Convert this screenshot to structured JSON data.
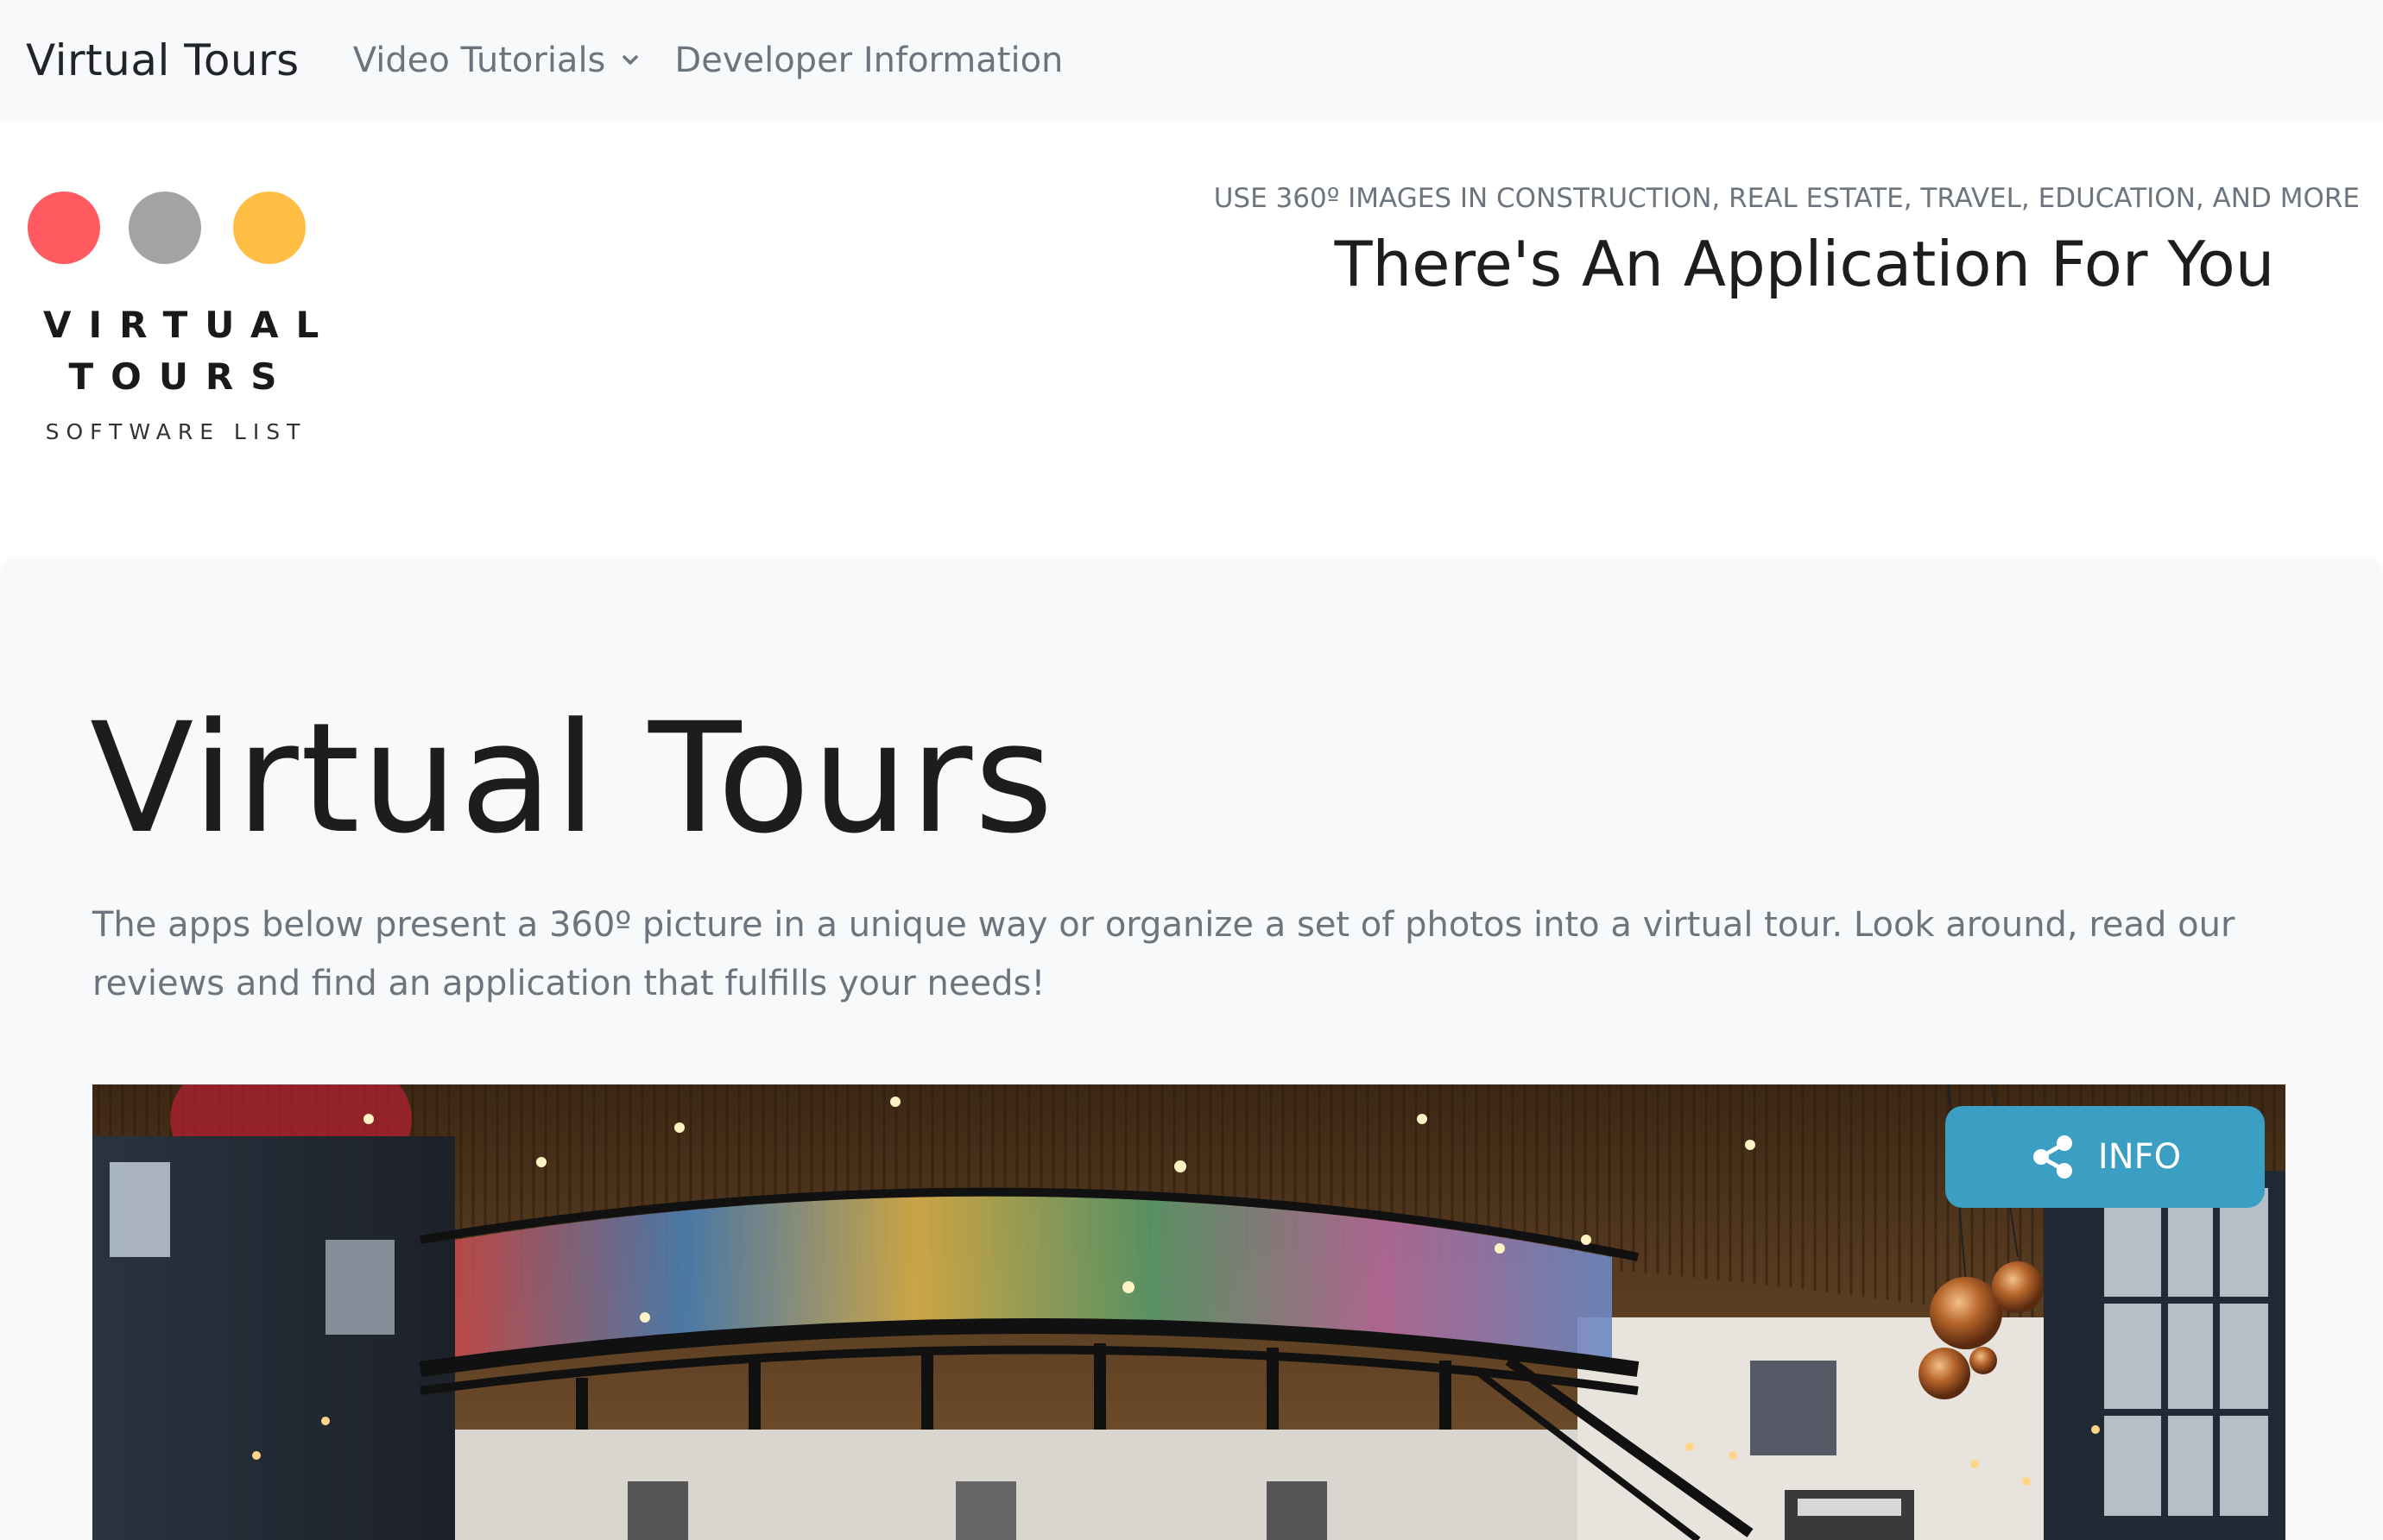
{
  "navbar": {
    "brand": "Virtual Tours",
    "items": [
      {
        "label": "Video Tutorials",
        "has_dropdown": true
      },
      {
        "label": "Developer Information",
        "has_dropdown": false
      }
    ]
  },
  "header": {
    "logo": {
      "line1": "VIRTUAL",
      "line2": "TOURS",
      "subtitle": "SOFTWARE LIST",
      "dot_colors": [
        "#ff5a5f",
        "#a3a3a3",
        "#ffbd44"
      ]
    },
    "tagline": "USE 360º IMAGES IN CONSTRUCTION, REAL ESTATE, TRAVEL, EDUCATION, AND MORE",
    "headline": "There's An Application For You"
  },
  "main": {
    "title": "Virtual Tours",
    "description": "The apps below present a 360º picture in a unique way or organize a set of photos into a virtual tour. Look around, read our reviews and find an application that fulfills your needs!",
    "panorama": {
      "info_button_label": "INFO",
      "info_button_icon": "share-icon"
    }
  },
  "colors": {
    "navbar_bg": "#f8f9fa",
    "main_bg": "#f8f9fb",
    "info_button": "#3a9fc2",
    "muted_text": "#6c757d"
  }
}
